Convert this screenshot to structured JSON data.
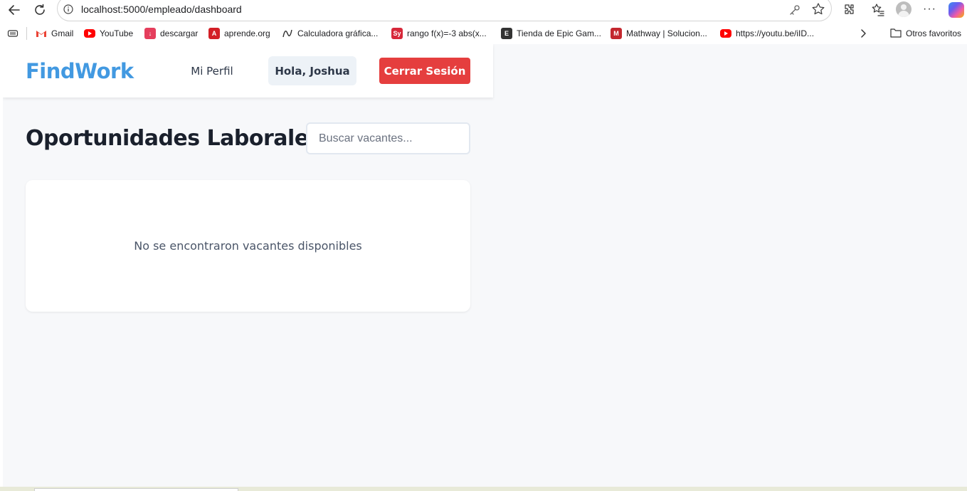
{
  "browser": {
    "url": "localhost:5000/empleado/dashboard",
    "bookmarks": [
      {
        "label": "Gmail",
        "icon": "gmail-icon",
        "color": "#ea4335"
      },
      {
        "label": "YouTube",
        "icon": "youtube-icon",
        "color": "#ff0000"
      },
      {
        "label": "descargar",
        "icon": "download-icon",
        "color": "#e53e5c"
      },
      {
        "label": "aprende.org",
        "icon": "aprende-icon",
        "color": "#d31f26"
      },
      {
        "label": "Calculadora gráfica...",
        "icon": "desmos-icon",
        "color": "#2f2f2f"
      },
      {
        "label": "rango f(x)=-3 abs(x...",
        "icon": "symbolab-icon",
        "color": "#d7283a"
      },
      {
        "label": "Tienda de Epic Gam...",
        "icon": "epic-games-icon",
        "color": "#333333"
      },
      {
        "label": "Mathway | Solucion...",
        "icon": "mathway-icon",
        "color": "#c3272e"
      },
      {
        "label": "https://youtu.be/iID...",
        "icon": "youtube-icon",
        "color": "#ff0000"
      }
    ],
    "other_favorites": "Otros favoritos"
  },
  "navbar": {
    "brand": "FindWork",
    "profile_link": "Mi Perfil",
    "greeting": "Hola, Joshua",
    "logout": "Cerrar Sesión"
  },
  "main": {
    "title": "Oportunidades Laborales",
    "search_placeholder": "Buscar vacantes...",
    "empty_message": "No se encontraron vacantes disponibles"
  },
  "colors": {
    "brand": "#4299e1",
    "logout_bg": "#e53e3e",
    "page_bg": "#f7f8fa"
  }
}
